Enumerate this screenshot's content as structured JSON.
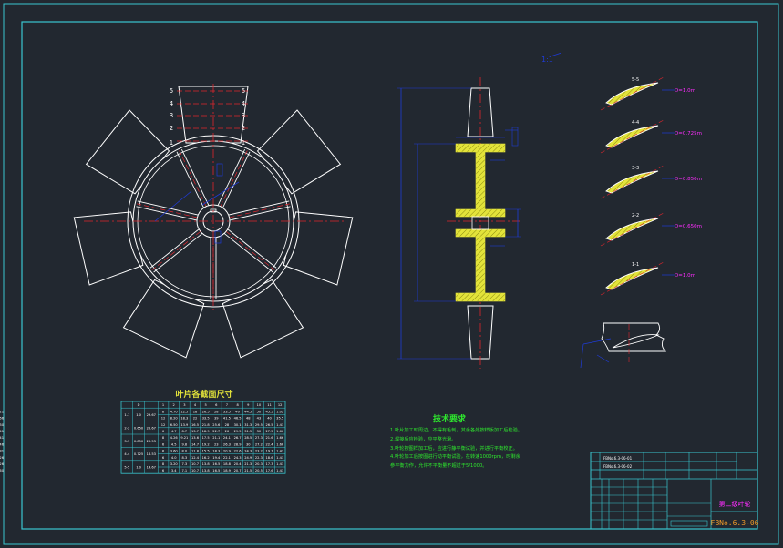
{
  "colors": {
    "background": "#222830",
    "frame": "#39c6cf",
    "outline": "#ffffff",
    "centerline": "#e0262d",
    "dimension": "#1f3bd6",
    "weld_fill": "#e3e33a",
    "notes": "#2ee62e",
    "magenta": "#ff2dff",
    "title_orange": "#f09a28"
  },
  "front_view": {
    "blade_count": 7,
    "blade_section_numbers": [
      "5",
      "4",
      "3",
      "2",
      "1"
    ]
  },
  "section_sketch": {
    "scale_label": "1:1",
    "sections": [
      {
        "label": "5-5",
        "diameter": "D=1.0m"
      },
      {
        "label": "4-4",
        "diameter": "D=0.725m"
      },
      {
        "label": "3-3",
        "diameter": "D=0.850m"
      },
      {
        "label": "2-2",
        "diameter": "D=0.650m"
      },
      {
        "label": "1-1",
        "diameter": "D=1.0m"
      }
    ]
  },
  "blade_table": {
    "title": "叶片各截面尺寸",
    "header": [
      "",
      "D",
      "",
      "1",
      "2",
      "3",
      "4",
      "5",
      "6",
      "7",
      "8",
      "9",
      "10",
      "11",
      "12"
    ],
    "rows": [
      {
        "section": "1-1",
        "d": "1.0",
        "a": "29.67",
        "cells": [
          "8",
          "4.70",
          "12.5",
          "18",
          "26.5",
          "28",
          "33.5",
          "40",
          "44.5",
          "50",
          "45.5",
          "1.02",
          "2.21"
        ]
      },
      {
        "section": "",
        "d": "",
        "a": "",
        "cells": [
          "12",
          "8.20",
          "18.3",
          "22",
          "33.5",
          "39",
          "41.5",
          "46.5",
          "48",
          "43",
          "40",
          "35.5",
          "1.66"
        ]
      },
      {
        "section": "2-2",
        "d": "0.650",
        "a": "25.67",
        "cells": [
          "12",
          "6.50",
          "13.9",
          "16.5",
          "21.8",
          "25.6",
          "28",
          "30.1",
          "31.3",
          "29.5",
          "26.5",
          "1.41",
          "3.30"
        ]
      },
      {
        "section": "",
        "d": "",
        "a": "",
        "cells": [
          "6",
          "4.7",
          "8.7",
          "13.7",
          "18.9",
          "22.7",
          "26",
          "29.5",
          "31.5",
          "30",
          "27.5",
          "1.66",
          "1.41"
        ]
      },
      {
        "section": "3-3",
        "d": "0.850",
        "a": "20.53",
        "cells": [
          "8",
          "4.26",
          "9.21",
          "13.6",
          "17.5",
          "21.1",
          "24.1",
          "26.7",
          "28.5",
          "27.3",
          "21.6",
          "1.66",
          "1.41"
        ]
      },
      {
        "section": "",
        "d": "",
        "a": "",
        "cells": [
          "6",
          "4.5",
          "9.8",
          "14.7",
          "19.2",
          "23",
          "26.3",
          "28.9",
          "30",
          "27.2",
          "22.4",
          "1.66",
          "2.46"
        ]
      },
      {
        "section": "4-4",
        "d": "0.725",
        "a": "16.53",
        "cells": [
          "8",
          "3.60",
          "8.0",
          "11.8",
          "15.5",
          "18.3",
          "20.9",
          "22.6",
          "24.3",
          "23.2",
          "19.7",
          "1.41",
          "2.81"
        ]
      },
      {
        "section": "",
        "d": "",
        "a": "",
        "cells": [
          "6",
          "4.0",
          "8.3",
          "12.4",
          "16.2",
          "19.4",
          "22.1",
          "24.3",
          "24.9",
          "22.3",
          "18.6",
          "1.41",
          "2.26"
        ]
      },
      {
        "section": "5-5",
        "d": "1.0",
        "a": "14.67",
        "cells": [
          "8",
          "3.20",
          "7.3",
          "10.7",
          "13.8",
          "16.5",
          "18.8",
          "20.4",
          "21.3",
          "20.3",
          "17.3",
          "1.41",
          "2.26"
        ]
      },
      {
        "section": "",
        "d": "",
        "a": "",
        "cells": [
          "6",
          "3.4",
          "7.1",
          "10.7",
          "13.8",
          "16.5",
          "18.9",
          "20.7",
          "21.5",
          "20.5",
          "17.6",
          "1.41",
          "2.60"
        ]
      }
    ]
  },
  "notes": {
    "title": "技术要求",
    "lines": [
      "1.叶片加工时周边，不得有毛刺，其余各处按样板加工后检验。",
      "2.焊接后应检验，应平整光滑。",
      "3.叶轮按图样加工后，应进行静平衡试验，并进行平衡校正。",
      "4.叶轮加工后按图进行动平衡试验，在转速1000rpm，时剩余",
      "  参平衡力作，允许不平衡量不超过于5/1000。"
    ]
  },
  "title_block": {
    "part_name": "第二级叶轮",
    "drawing_no": "FBNo.6.3-06",
    "ref1": "FBNo.6.3-06-01",
    "ref2": "FBNo.6.3-06-02"
  }
}
